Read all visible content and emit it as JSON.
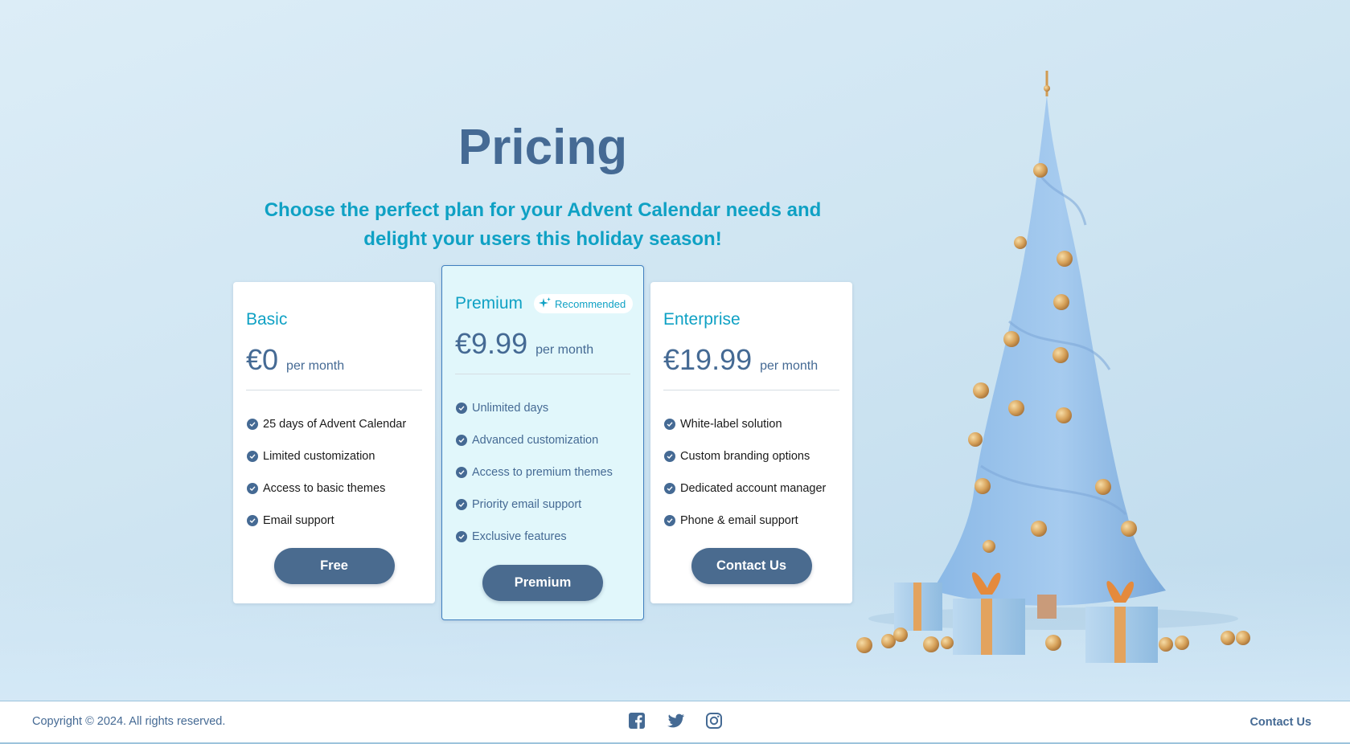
{
  "header": {
    "title": "Pricing",
    "subtitle": "Choose the perfect plan for your Advent Calendar needs and delight your users this holiday season!"
  },
  "plans": [
    {
      "name": "Basic",
      "price": "€0",
      "period": "per month",
      "features": [
        "25 days of Advent Calendar",
        "Limited customization",
        "Access to basic themes",
        "Email support"
      ],
      "button": "Free"
    },
    {
      "name": "Premium",
      "badge": "Recommended",
      "price": "€9.99",
      "period": "per month",
      "features": [
        "Unlimited days",
        "Advanced customization",
        "Access to premium themes",
        "Priority email support",
        "Exclusive features"
      ],
      "button": "Premium"
    },
    {
      "name": "Enterprise",
      "price": "€19.99",
      "period": "per month",
      "features": [
        "White-label solution",
        "Custom branding options",
        "Dedicated account manager",
        "Phone & email support"
      ],
      "button": "Contact Us"
    }
  ],
  "footer": {
    "copyright": "Copyright © 2024. All rights reserved.",
    "socials": [
      "facebook-icon",
      "twitter-icon",
      "instagram-icon"
    ],
    "contact": "Contact Us"
  },
  "colors": {
    "primary": "#456a94",
    "accent": "#0fa1c4",
    "button": "#4a6b8f",
    "premium_bg": "#e1f7fb"
  }
}
